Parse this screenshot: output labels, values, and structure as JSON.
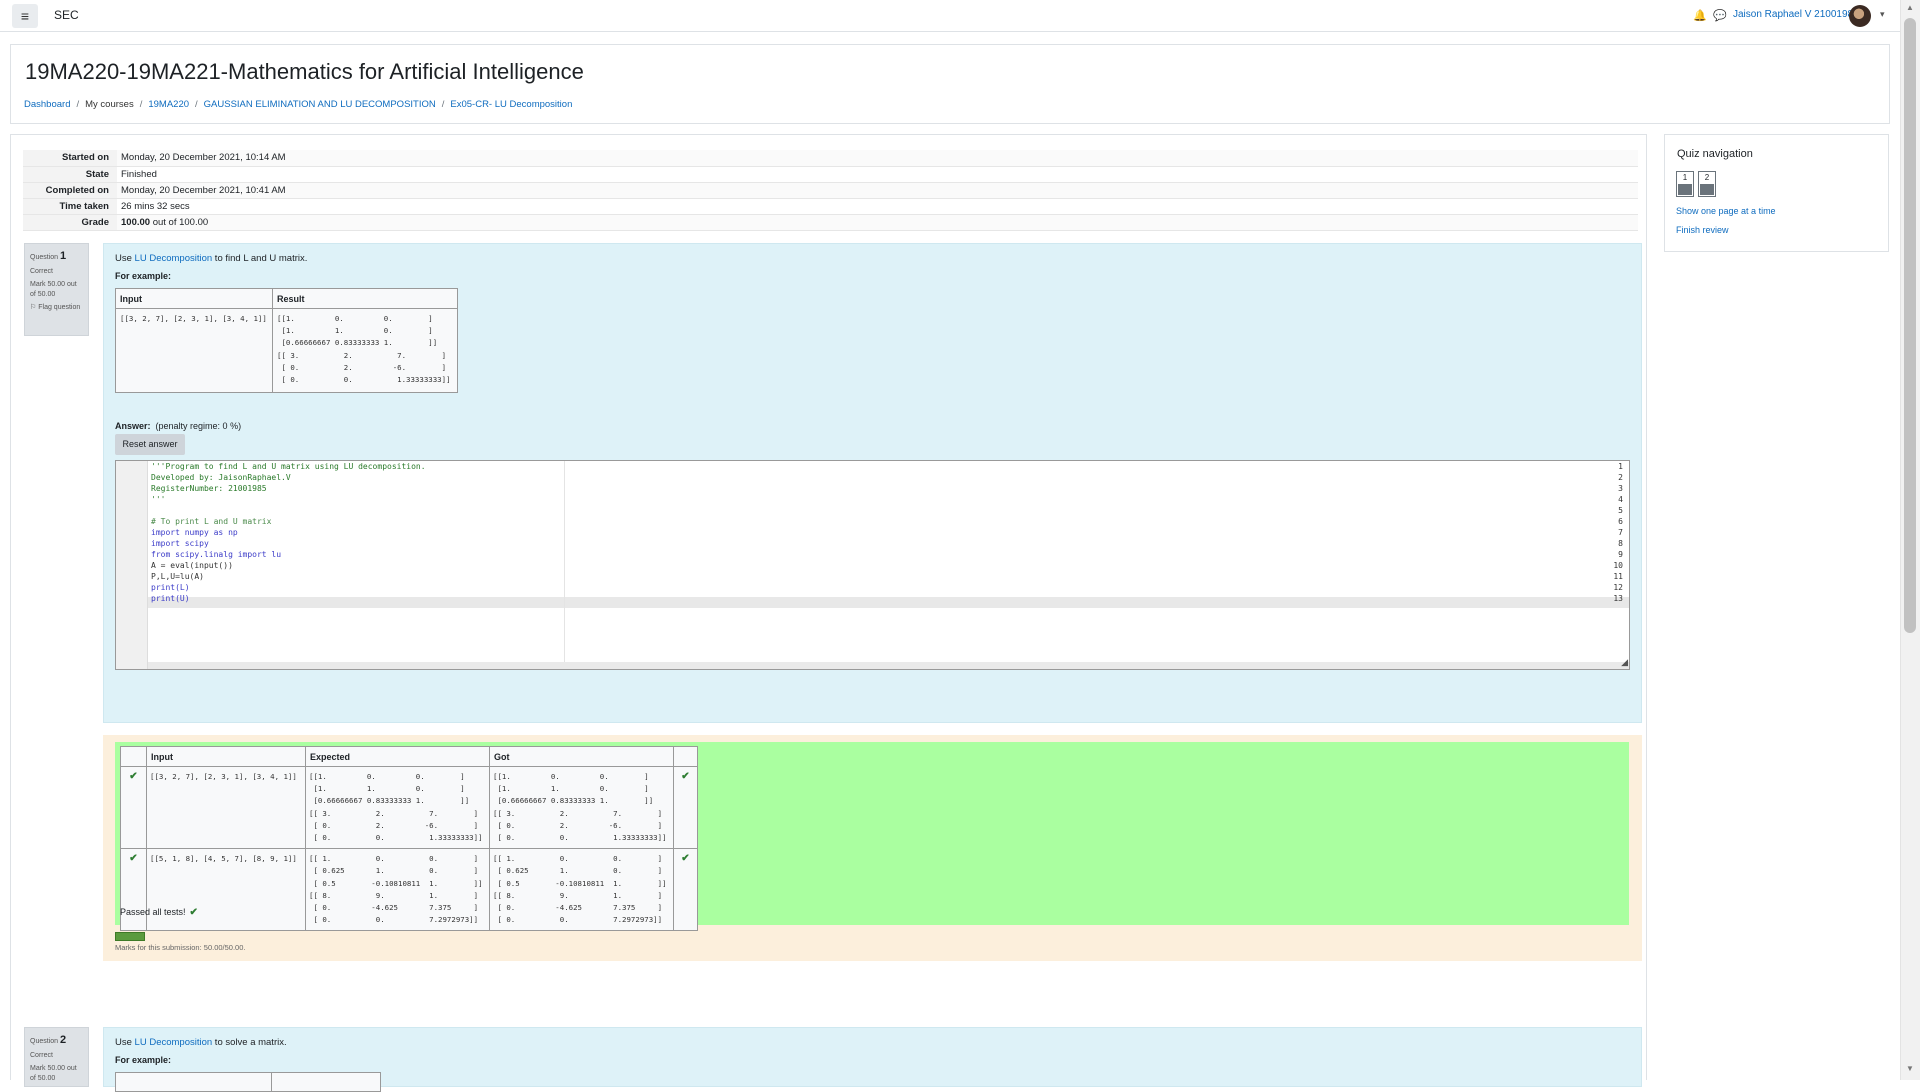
{
  "topbar": {
    "menu_icon": "hamburger-icon",
    "site_name": "SEC",
    "user_name": "Jaison Raphael V 21001985",
    "caret": "▾"
  },
  "header": {
    "course_title": "19MA220-19MA221-Mathematics for Artificial Intelligence",
    "breadcrumb": [
      "Dashboard",
      "My courses",
      "19MA220",
      "GAUSSIAN ELIMINATION AND LU DECOMPOSITION",
      "Ex05-CR- LU Decomposition"
    ]
  },
  "summary": [
    {
      "label": "Started on",
      "value": "Monday, 20 December 2021, 10:14 AM"
    },
    {
      "label": "State",
      "value": "Finished"
    },
    {
      "label": "Completed on",
      "value": "Monday, 20 December 2021, 10:41 AM"
    },
    {
      "label": "Time taken",
      "value": "26 mins 32 secs"
    },
    {
      "label": "Grade",
      "value_bold": "100.00",
      "value_rest": " out of 100.00"
    }
  ],
  "question1": {
    "prefix": "Question",
    "number": "1",
    "status": "Correct",
    "mark": "Mark 50.00 out of 50.00",
    "flag": "Flag question",
    "text_before": "Use ",
    "link_text": "LU Decomposition",
    "text_after": " to find L and U matrix.",
    "for_example": "For example:",
    "example_headers": [
      "Input",
      "Result"
    ],
    "example_input": "[[3, 2, 7], [2, 3, 1], [3, 4, 1]]",
    "example_result": "[[1.         0.         0.        ]\n [1.         1.         0.        ]\n [0.66666667 0.83333333 1.        ]]\n[[ 3.          2.          7.        ]\n [ 0.          2.         -6.        ]\n [ 0.          0.          1.33333333]]",
    "answer_label": "Answer:",
    "penalty": "(penalty regime: 0 %)",
    "reset_button": "Reset answer",
    "code": [
      "'''Program to find L and U matrix using LU decomposition.",
      "Developed by: JaisonRaphael.V",
      "RegisterNumber: 21001985",
      "'''",
      "",
      "# To print L and U matrix",
      "import numpy as np",
      "import scipy",
      "from scipy.linalg import lu",
      "A = eval(input())",
      "P,L,U=lu(A)",
      "print(L)",
      "print(U)"
    ]
  },
  "results": {
    "headers": [
      "",
      "Input",
      "Expected",
      "Got",
      ""
    ],
    "rows": [
      {
        "input": "[[3, 2, 7], [2, 3, 1], [3, 4, 1]]",
        "expected": "[[1.         0.         0.        ]\n [1.         1.         0.        ]\n [0.66666667 0.83333333 1.        ]]\n[[ 3.          2.          7.        ]\n [ 0.          2.         -6.        ]\n [ 0.          0.          1.33333333]]",
        "got": "[[1.         0.         0.        ]\n [1.         1.         0.        ]\n [0.66666667 0.83333333 1.        ]]\n[[ 3.          2.          7.        ]\n [ 0.          2.         -6.        ]\n [ 0.          0.          1.33333333]]"
      },
      {
        "input": "[[5, 1, 8], [4, 5, 7], [8, 9, 1]]",
        "expected": "[[ 1.          0.          0.        ]\n [ 0.625       1.          0.        ]\n [ 0.5        -0.10810811  1.        ]]\n[[ 8.          9.          1.        ]\n [ 0.         -4.625       7.375     ]\n [ 0.          0.          7.2972973]]",
        "got": "[[ 1.          0.          0.        ]\n [ 0.625       1.          0.        ]\n [ 0.5        -0.10810811  1.        ]]\n[[ 8.          9.          1.        ]\n [ 0.         -4.625       7.375     ]\n [ 0.          0.          7.2972973]]"
      }
    ],
    "passed_text": "Passed all tests!",
    "check": "✔",
    "marks_text": "Marks for this submission: 50.00/50.00.",
    "progress": 1.0
  },
  "question2": {
    "prefix": "Question",
    "number": "2",
    "status": "Correct",
    "mark": "Mark 50.00 out of 50.00",
    "text_before": "Use ",
    "link_text": "LU Decomposition",
    "text_after": " to solve a matrix.",
    "for_example": "For example:"
  },
  "quiz_nav": {
    "title": "Quiz navigation",
    "buttons": [
      "1",
      "2"
    ],
    "show_one_page": "Show one page at a time",
    "finish_review": "Finish review"
  },
  "icons": {
    "bell": "🔔",
    "chat": "💬",
    "flag": "⚐",
    "scroll_up": "▲",
    "scroll_down": "▼",
    "resize": "◢"
  },
  "colors": {
    "link": "#0f6cbf",
    "question_bg": "#def2f8",
    "feedback_bg": "#fcefdc",
    "pass_bg": "#aaffa0",
    "correct": "#2e7d32"
  }
}
